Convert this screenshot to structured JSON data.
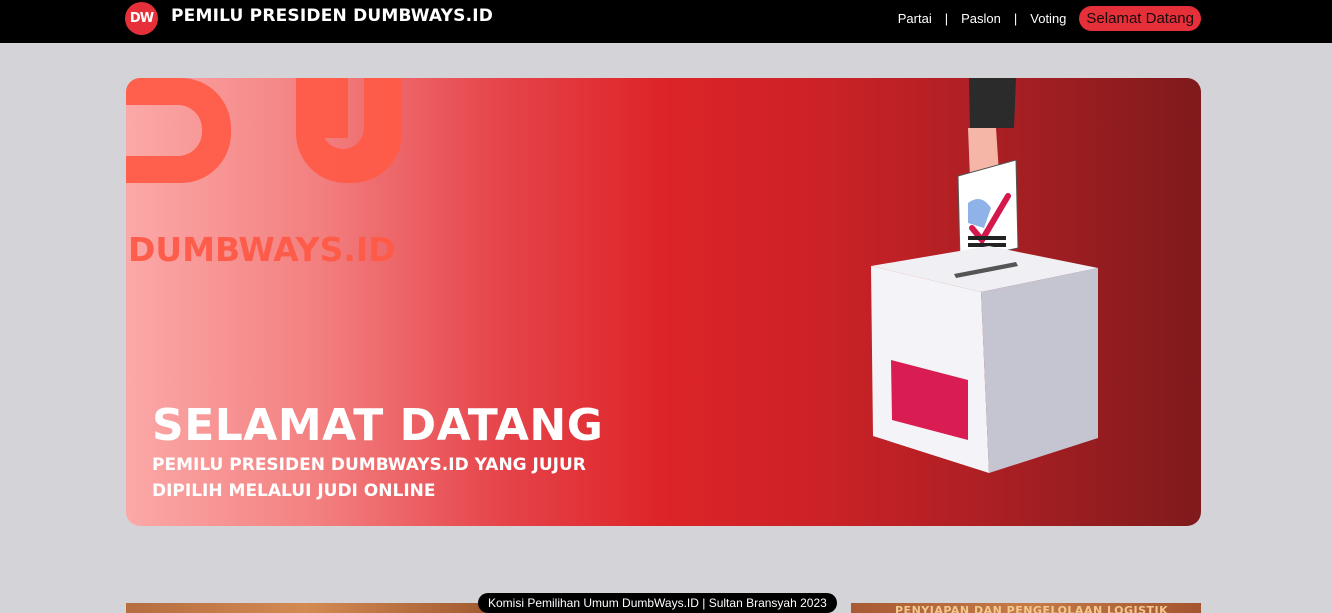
{
  "navbar": {
    "logo_text": "DW",
    "title": "PEMILU PRESIDEN DUMBWAYS.ID",
    "links": [
      {
        "label": "Partai"
      },
      {
        "label": "Paslon"
      },
      {
        "label": "Voting"
      }
    ],
    "separator": "|",
    "cta_label": "Selamat Datang"
  },
  "hero": {
    "watermark_text": "DUMBWAYS.ID",
    "heading": "SELAMAT DATANG",
    "subtitle_line1": "PEMILU PRESIDEN DUMBWAYS.ID YANG JUJUR",
    "subtitle_line2": "DIPILIH MELALUI JUDI ONLINE",
    "illustration": "ballot-box-icon"
  },
  "bottom": {
    "right_banner_text": "PENYIAPAN DAN PENGELOLAAN LOGISTIK"
  },
  "footer": {
    "text": "Komisi Pemilihan Umum DumbWays.ID | Sultan Bransyah 2023"
  },
  "colors": {
    "accent": "#e5303a",
    "navbar_bg": "#000000",
    "page_bg": "#d4d3d8"
  }
}
